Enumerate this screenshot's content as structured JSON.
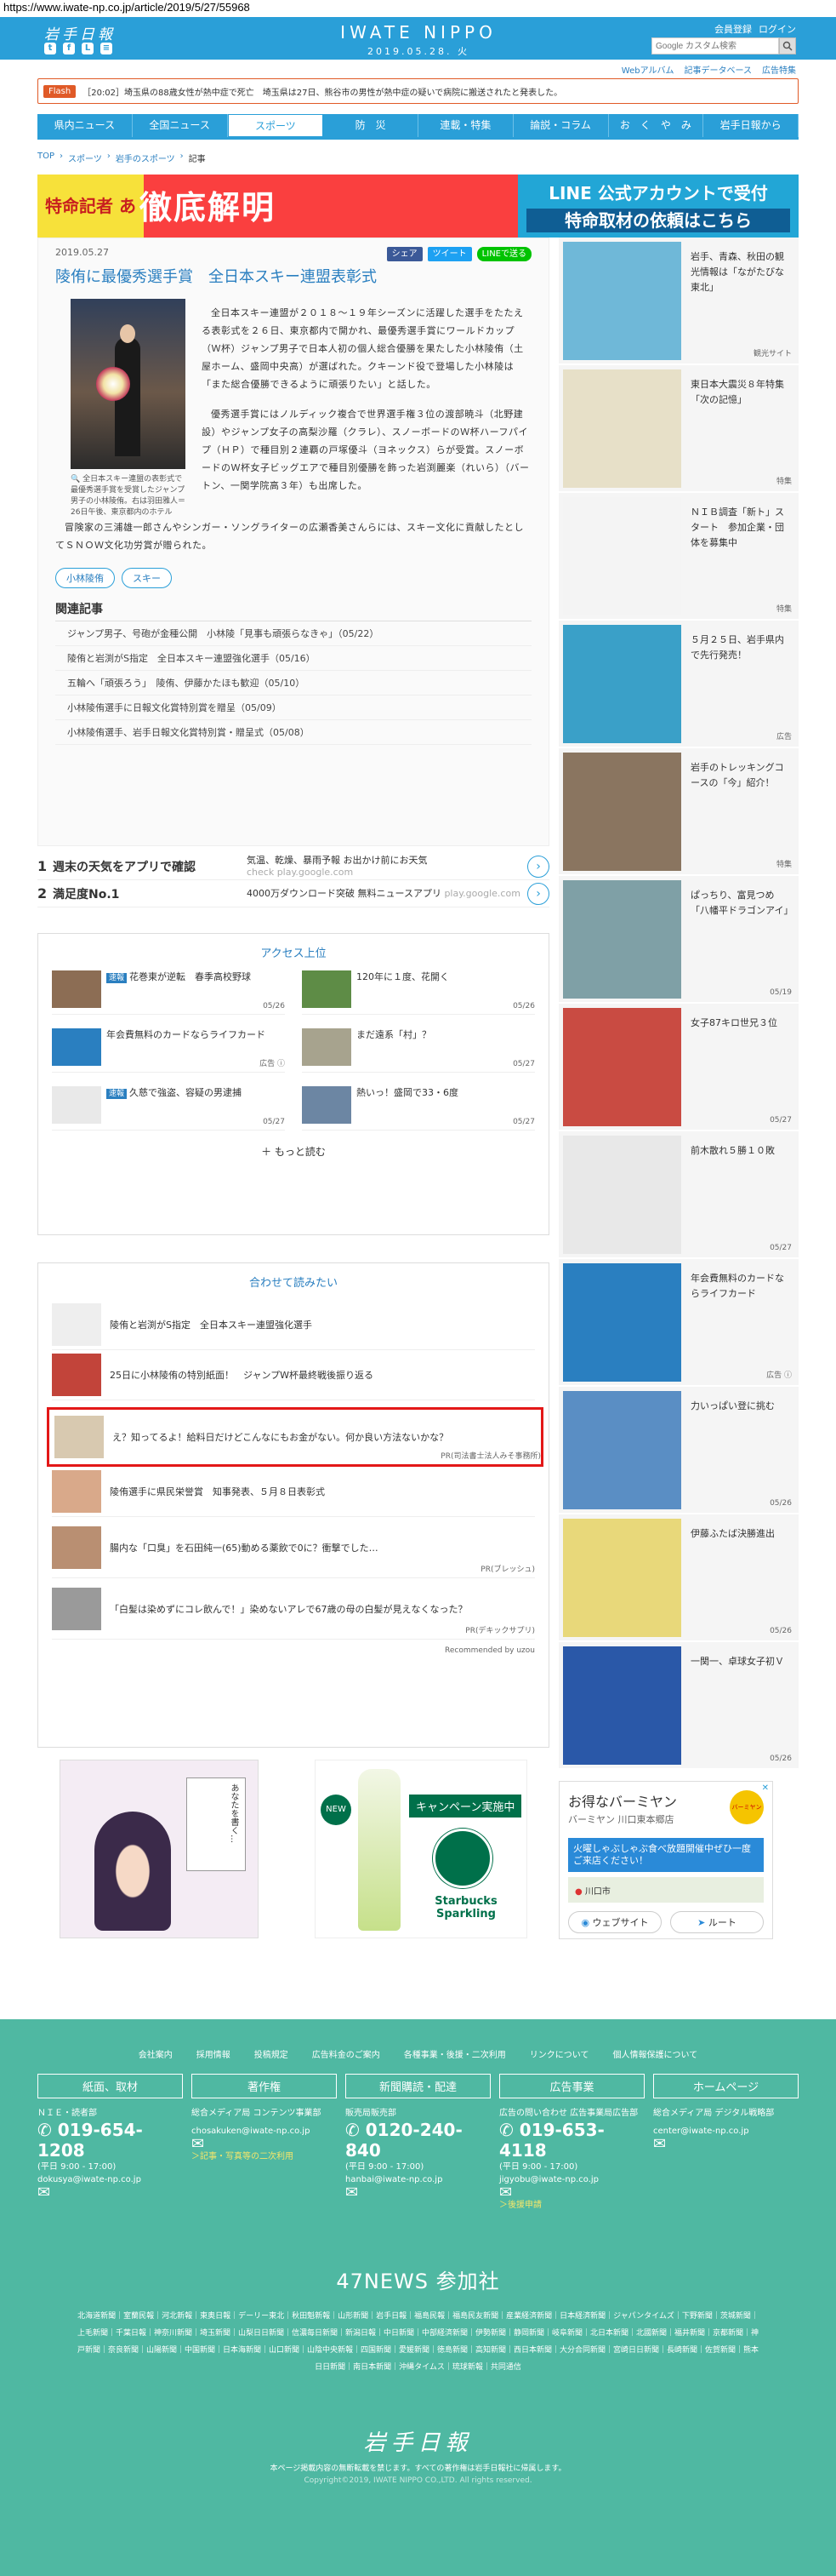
{
  "url": "https://www.iwate-np.co.jp/article/2019/5/27/55968",
  "header": {
    "logo_left": "岩手日報",
    "brand": "IWATE NIPPO",
    "date": "2019.05.28. 火",
    "member_register": "会員登録",
    "login": "ログイン",
    "search_placeholder": "Google カスタム検索",
    "subnav": [
      "Webアルバム",
      "記事データベース",
      "広告特集"
    ]
  },
  "flash": {
    "label": "Flash",
    "text": "［20:02］埼玉県の88歳女性が熱中症で死亡　埼玉県は27日、熊谷市の男性が熱中症の疑いで病院に搬送されたと発表した。"
  },
  "nav": {
    "tabs": [
      "県内ニュース",
      "全国ニュース",
      "スポーツ",
      "防　災",
      "連載・特集",
      "論説・コラム",
      "お　く　や　み",
      "岩手日報から"
    ],
    "active_index": 2
  },
  "breadcrumb": [
    "TOP",
    "スポーツ",
    "岩手のスポーツ",
    "記事"
  ],
  "banner": {
    "left": "特命記者 あなたの疑問",
    "main": "徹底解明",
    "right_line1": "LINE 公式アカウントで受付",
    "right_line2": "特命取材の依頼はこちら"
  },
  "article": {
    "date": "2019.05.27",
    "share_fb": "シェア",
    "share_tw": "ツイート",
    "share_line": "LINEで送る",
    "title": "陵侑に最優秀選手賞　全日本スキー連盟表彰式",
    "photo_caption": "全日本スキー連盟の表彰式で最優秀選手賞を受賞したジャンプ男子の小林陵侑。右は羽田雅人＝26日午後、東京都内のホテル",
    "paragraphs": [
      "全日本スキー連盟が２０１８～１９年シーズンに活躍した選手をたたえる表彰式を２６日、東京都内で開かれ、最優秀選手賞にワールドカップ（Ｗ杯）ジャンプ男子で日本人初の個人総合優勝を果たした小林陵侑（土屋ホーム、盛岡中央高）が選ばれた。クキーンド役で登場した小林陵は「また総合優勝できるように頑張りたい」と話した。",
      "優秀選手賞にはノルディック複合で世界選手権３位の渡部暁斗（北野建設）やジャンプ女子の高梨沙羅（クラレ）、スノーボードのＷ杯ハーフパイプ（ＨＰ）で種目別２連覇の戸塚優斗（ヨネックス）らが受賞。スノーボードのＷ杯女子ビッグエアで種目別優勝を飾った岩渕麗楽（れいら）（バートン、一関学院高３年）も出席した。",
      "冒険家の三浦雄一郎さんやシンガー・ソングライターの広瀬香美さんらには、スキー文化に貢献したとしてＳＮＯＷ文化功労賞が贈られた。"
    ],
    "tags": [
      "小林陵侑",
      "スキー"
    ],
    "related_title": "関連記事",
    "related": [
      "ジャンプ男子、号砲が金種公開　小林陵「見事も頑張らなきゃ」（05/22）",
      "陵侑と岩渕がS指定　全日本スキー連盟強化選手（05/16）",
      "五輪へ「頑張ろう」　陵侑、伊藤かたほも歓迎（05/10）",
      "小林陵侑選手に日報文化賞特別賞を贈呈（05/09）",
      "小林陵侑選手、岩手日報文化賞特別賞・贈呈式（05/08）"
    ]
  },
  "text_ads": [
    {
      "num": "1",
      "head": "週末の天気をアプリで確認",
      "desc": "気温、乾燥、暴雨予報 お出かけ前にお天気",
      "url": "check play.google.com"
    },
    {
      "num": "2",
      "head": "満足度No.1",
      "desc": "4000万ダウンロード突破 無料ニュースアプリ",
      "url": "play.google.com"
    }
  ],
  "access": {
    "title": "アクセス上位",
    "items": [
      {
        "badge": "速報",
        "text": "花巻東が逆転　春季高校野球",
        "date": "05/26"
      },
      {
        "badge": "",
        "text": "120年に１度、花開く",
        "date": "05/26"
      },
      {
        "badge": "",
        "text": "年会費無料のカードならライフカード",
        "date": "広告 ⓘ"
      },
      {
        "badge": "",
        "text": "まだ遠系「村」？",
        "date": "05/27"
      },
      {
        "badge": "速報",
        "text": "久慈で強盗、容疑の男逮捕",
        "date": "05/27"
      },
      {
        "badge": "",
        "text": "熱いっ！盛岡で33・6度",
        "date": "05/27"
      }
    ],
    "more": "もっと読む"
  },
  "recommend": {
    "title": "合わせて読みたい",
    "items": [
      {
        "text": "陵侑と岩渕がS指定　全日本スキー連盟強化選手",
        "pr": ""
      },
      {
        "text": "25日に小林陵侑の特別紙面！　ジャンプW杯最終戦後振り返る",
        "pr": ""
      },
      {
        "text": "え？知ってるよ！給料日だけどこんなにもお金がない。何か良い方法ないかな？",
        "pr": "PR(司法書士法人みそ事務所)"
      },
      {
        "text": "陵侑選手に県民栄誉賞　知事発表、５月８日表彰式",
        "pr": ""
      },
      {
        "text": "腸内な「口臭」を石田純一(65)動める薬飲で0に？衝撃でした…",
        "pr": "PR(ブレッシュ)"
      },
      {
        "text": "「白髪は染めずにコレ飲んで！」染めないアレで67歳の母の白髪が見えなくなった？",
        "pr": "PR(デキックサプリ)"
      }
    ],
    "powered": "Recommended by uzou"
  },
  "bottom_ads": {
    "manga": "あなたを書く…",
    "starbucks_campaign": "キャンペーン実施中",
    "starbucks_brand": "Starbucks Sparkling",
    "starbucks_new": "NEW"
  },
  "sidebar": [
    {
      "text": "岩手、青森、秋田の観光情報は「ながたびな東北」",
      "meta": "観光サイト",
      "color": "#6fb8d8"
    },
    {
      "text": "東日本大震災８年特集「次の記憶」",
      "meta": "特集",
      "color": "#e7e0c8"
    },
    {
      "text": "ＮＩＢ調査「新ト」スタート　参加企業・団体を募集中",
      "meta": "特集",
      "color": "#f4f4f4"
    },
    {
      "text": "５月２５日、岩手県内で先行発売！",
      "meta": "広告",
      "color": "#3aa0c8"
    },
    {
      "text": "岩手のトレッキングコースの「今」紹介！",
      "meta": "特集",
      "color": "#8a7560"
    },
    {
      "text": "ぱっちり、富見つめ「八幡平ドラゴンアイ」",
      "meta": "05/19",
      "color": "#7fa0a6"
    },
    {
      "text": "女子87キロ世兄３位",
      "meta": "05/27",
      "color": "#c94b42"
    },
    {
      "text": "前木散れ５勝１０敗",
      "meta": "05/27",
      "color": "#e8e8e8"
    },
    {
      "text": "年会費無料のカードならライフカード",
      "meta": "広告 ⓘ",
      "color": "#2a7fc0"
    },
    {
      "text": "力いっぱい登に挑む",
      "meta": "05/26",
      "color": "#5a8ec4"
    },
    {
      "text": "伊藤ふたば決勝進出",
      "meta": "05/26",
      "color": "#e8d87a"
    },
    {
      "text": "一関一、卓球女子初Ｖ",
      "meta": "05/26",
      "color": "#2a58a8"
    }
  ],
  "side_ad": {
    "title": "お得なバーミヤン",
    "sub": "バーミヤン 川口東本郷店",
    "brand": "バーミヤン",
    "promo": "火曜しゃぶしゃぶ食べ放題開催中ぜひ一度ご来店ください！",
    "location": "川口市",
    "website": "ウェブサイト",
    "route": "ルート"
  },
  "footer": {
    "links": [
      "会社案内",
      "採用情報",
      "投稿規定",
      "広告料金のご案内",
      "各種事業・後援・二次利用",
      "リンクについて",
      "個人情報保護について"
    ],
    "cols": [
      {
        "head": "紙面、取材",
        "dept": "ＮＩＥ・読者部",
        "phone": "019-654-1208",
        "hours": "(平日 9:00 - 17:00)",
        "email": "dokusya@iwate-np.co.jp",
        "extra": ""
      },
      {
        "head": "著作権",
        "dept": "総合メディア局 コンテンツ事業部",
        "phone": "",
        "hours": "",
        "email": "chosakuken@iwate-np.co.jp",
        "extra": "＞記事・写真等の二次利用"
      },
      {
        "head": "新聞購読・配達",
        "dept": "販売局販売部",
        "phone": "0120-240-840",
        "hours": "(平日 9:00 - 17:00)",
        "email": "hanbai@iwate-np.co.jp",
        "extra": ""
      },
      {
        "head": "広告事業",
        "dept": "広告の問い合わせ 広告事業局広告部",
        "phone": "019-653-4118",
        "hours": "(平日 9:00 - 17:00)",
        "email": "jigyobu@iwate-np.co.jp",
        "extra": "＞後援申請"
      },
      {
        "head": "ホームページ",
        "dept": "総合メディア局 デジタル戦略部",
        "phone": "",
        "hours": "",
        "email": "center@iwate-np.co.jp",
        "extra": ""
      }
    ],
    "n47_title": "47NEWS 参加社",
    "n47_papers": "北海道新聞｜室蘭民報｜河北新報｜東奥日報｜デーリー東北｜秋田魁新報｜山形新聞｜岩手日報｜福島民報｜福島民友新聞｜産業経済新聞｜日本経済新聞｜ジャパンタイムズ｜下野新聞｜茨城新聞｜上毛新聞｜千葉日報｜神奈川新聞｜埼玉新聞｜山梨日日新聞｜信濃毎日新聞｜新潟日報｜中日新聞｜中部経済新聞｜伊勢新聞｜静岡新聞｜岐阜新聞｜北日本新聞｜北國新聞｜福井新聞｜京都新聞｜神戸新聞｜奈良新聞｜山陽新聞｜中国新聞｜日本海新聞｜山口新聞｜山陰中央新報｜四国新聞｜愛媛新聞｜徳島新聞｜高知新聞｜西日本新聞｜大分合同新聞｜宮崎日日新聞｜長崎新聞｜佐賀新聞｜熊本日日新聞｜南日本新聞｜沖縄タイムス｜琉球新報｜共同通信",
    "logo": "岩手日報",
    "note": "本ページ掲載内容の無断転載を禁じます。すべての著作権は岩手日報社に帰属します。",
    "copyright": "Copyright©2019, IWATE NIPPO CO.,LTD. All rights reserved."
  }
}
